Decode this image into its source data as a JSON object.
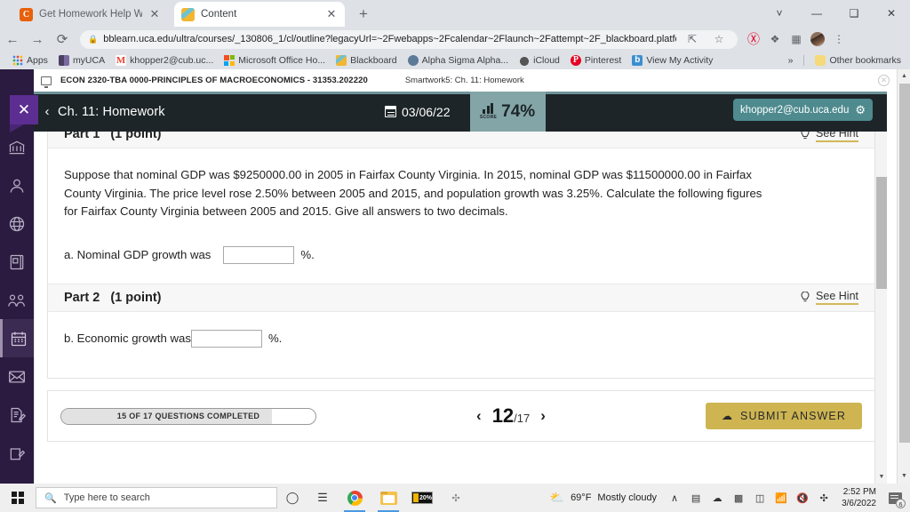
{
  "browser": {
    "tabs": [
      {
        "title": "Get Homework Help With Chegg",
        "favicon": "chegg-icon",
        "active": false
      },
      {
        "title": "Content",
        "favicon": "blackboard-icon",
        "active": true
      }
    ],
    "new_tab_label": "+",
    "window_controls": [
      "chevron-down-icon",
      "minimize-icon",
      "maximize-icon",
      "close-icon"
    ],
    "nav": {
      "back": "←",
      "forward": "→",
      "reload": "⟳"
    },
    "url": "bblearn.uca.edu/ultra/courses/_130806_1/cl/outline?legacyUrl=~2Fwebapps~2Fcalendar~2Flaunch~2Fattempt~2F_blackboard.platform.gradeb...",
    "lock_icon": "lock-icon",
    "toolbar_icons": [
      "share-icon",
      "bookmark-star-icon",
      "pinterest-icon",
      "extensions-puzzle-icon",
      "reading-list-icon",
      "profile-avatar",
      "chrome-menu-icon"
    ],
    "bookmarks": [
      {
        "label": "Apps",
        "icon": "apps-grid-icon"
      },
      {
        "label": "myUCA",
        "icon": "uca-icon"
      },
      {
        "label": "khopper2@cub.uc...",
        "icon": "gmail-icon"
      },
      {
        "label": "Microsoft Office Ho...",
        "icon": "microsoft-icon"
      },
      {
        "label": "Blackboard",
        "icon": "blackboard-icon"
      },
      {
        "label": "Alpha Sigma Alpha...",
        "icon": "globe-icon"
      },
      {
        "label": "iCloud",
        "icon": "apple-icon"
      },
      {
        "label": "Pinterest",
        "icon": "pinterest-icon"
      },
      {
        "label": "View My Activity",
        "icon": "bing-icon"
      }
    ],
    "bookmarks_overflow": "»",
    "other_bookmarks": "Other bookmarks"
  },
  "blackboard": {
    "close_label": "✕",
    "nav_items": [
      {
        "name": "institution-page",
        "icon": "institution-icon"
      },
      {
        "name": "profile",
        "icon": "person-icon"
      },
      {
        "name": "activity-stream",
        "icon": "globe-icon"
      },
      {
        "name": "courses",
        "icon": "book-icon"
      },
      {
        "name": "organizations",
        "icon": "groups-icon"
      },
      {
        "name": "calendar",
        "icon": "calendar-icon",
        "active": true
      },
      {
        "name": "messages",
        "icon": "envelope-icon"
      },
      {
        "name": "grades",
        "icon": "grades-document-icon"
      },
      {
        "name": "tools",
        "icon": "tools-icon"
      }
    ],
    "course_title": "ECON 2320-TBA 0000-PRINCIPLES OF MACROECONOMICS - 31353.202220",
    "course_subtitle": "Smartwork5: Ch. 11: Homework",
    "course_close": "✕"
  },
  "smartwork": {
    "back_arrow": "‹",
    "title": "Ch. 11: Homework",
    "date": "03/06/22",
    "score_label": "SCORE",
    "score_value": "74%",
    "user_email": "khopper2@cub.uca.edu",
    "gear_icon": "gear-icon"
  },
  "question": {
    "parts": [
      {
        "label": "Part 1",
        "points": "(1 point)",
        "hint_label": "See Hint",
        "hint_icon": "lightbulb-icon",
        "text": "Suppose that nominal GDP was $9250000.00 in 2005 in Fairfax County Virginia. In 2015, nominal GDP was $11500000.00 in Fairfax County Virginia. The price level rose 2.50% between 2005 and 2015, and population growth was 3.25%. Calculate the following figures for Fairfax County Virginia between 2005 and 2015. Give all answers to two decimals.",
        "answer_label": "a. Nominal GDP growth was",
        "answer_value": "",
        "answer_suffix": "%."
      },
      {
        "label": "Part 2",
        "points": "(1 point)",
        "hint_label": "See Hint",
        "hint_icon": "lightbulb-icon",
        "text": "",
        "answer_label": "b. Economic growth was",
        "answer_value": "",
        "answer_suffix": "%."
      }
    ]
  },
  "footer": {
    "progress_text": "15 OF 17 QUESTIONS COMPLETED",
    "progress_percent": 83,
    "prev_arrow": "‹",
    "page_current": "12",
    "page_total": "/17",
    "next_arrow": "›",
    "submit_label": "SUBMIT ANSWER",
    "submit_icon": "cloud-upload-icon",
    "submit_color": "#ceb552"
  },
  "taskbar": {
    "start_icon": "windows-logo-icon",
    "search_placeholder": "Type here to search",
    "search_icon": "search-icon",
    "cortana_icon": "cortana-circle-icon",
    "taskview_icon": "task-view-icon",
    "apps": [
      {
        "name": "chrome",
        "icon": "chrome-icon",
        "active": true
      },
      {
        "name": "file-explorer",
        "icon": "folder-icon",
        "active": true
      },
      {
        "name": "battery-app",
        "icon": "battery-icon",
        "label": "20%"
      }
    ],
    "tray_expand": "∧",
    "tray_icons": [
      "meet-now-icon",
      "onedrive-cloud-icon",
      "screen-capture-icon",
      "battery-icon",
      "wifi-icon",
      "volume-muted-icon",
      "bluetooth-icon"
    ],
    "weather_icon": "partly-cloudy-icon",
    "weather_temp": "69°F",
    "weather_desc": "Mostly cloudy",
    "time": "2:52 PM",
    "date": "3/6/2022",
    "notification_count": "6"
  }
}
